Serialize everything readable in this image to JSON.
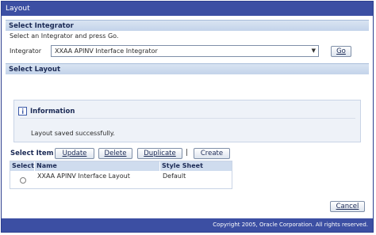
{
  "window": {
    "title": "Layout"
  },
  "integrator_section": {
    "heading": "Select Integrator",
    "instruction": "Select an Integrator and press Go.",
    "field_label": "Integrator",
    "selected_value": "XXAA APINV Interface Integrator",
    "go_label": "Go"
  },
  "layout_section": {
    "heading": "Select Layout"
  },
  "info": {
    "title": "Information",
    "icon": "info-icon",
    "message": "Layout saved successfully."
  },
  "actions": {
    "select_item_label": "Select Item",
    "update_label": "Update",
    "delete_label": "Delete",
    "duplicate_label": "Duplicate",
    "separator": "|",
    "create_label": "Create"
  },
  "table": {
    "headers": {
      "select": "Select",
      "name": "Name",
      "style_sheet": "Style Sheet"
    },
    "rows": [
      {
        "name": "XXAA APINV Interface Layout",
        "style_sheet": "Default"
      }
    ]
  },
  "cancel_label": "Cancel",
  "footer": {
    "copyright": "Copyright 2005, Oracle Corporation. All rights reserved."
  },
  "colors": {
    "titlebar": "#3c4fa3",
    "section": "#c3d3ea",
    "info_icon": "#3c5aa8"
  }
}
